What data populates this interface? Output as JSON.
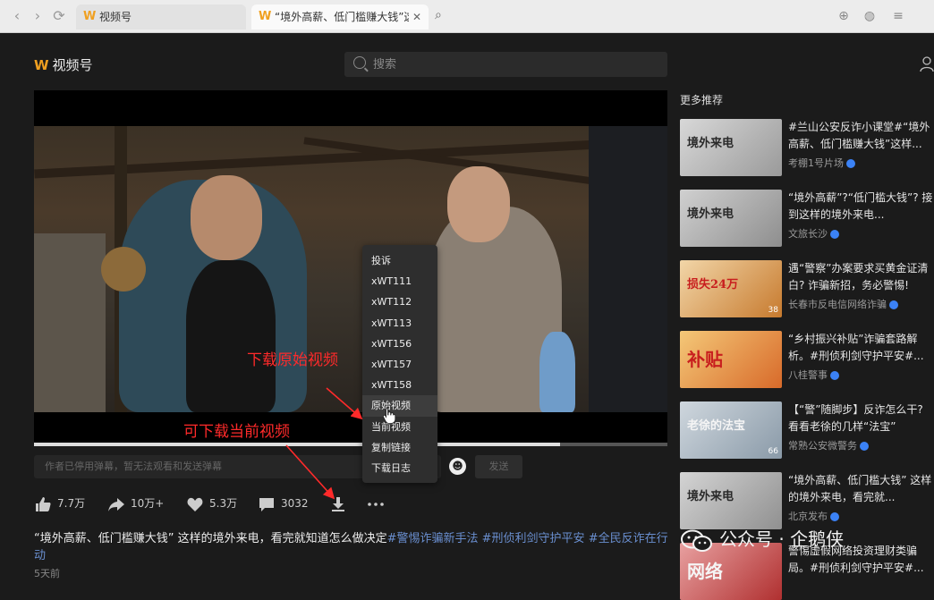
{
  "browser": {
    "tab1_title": "视频号",
    "tab2_title": "“境外高薪、低门槛赚大钱”这",
    "tab_logo": "W"
  },
  "header": {
    "logo_text": "视频号",
    "logo_mark": "W",
    "search_placeholder": "搜索"
  },
  "player": {
    "progress": 0.83,
    "danmu_placeholder": "作者已停用弹幕，暂无法观看和发送弹幕",
    "danmu_send": "发送",
    "danmu_emoji": "☻"
  },
  "actions": {
    "like_count": "7.7万",
    "share_count": "10万+",
    "heart_count": "5.3万",
    "comment_count": "3032"
  },
  "context_menu": {
    "items": [
      "投诉",
      "xWT111",
      "xWT112",
      "xWT113",
      "xWT156",
      "xWT157",
      "xWT158",
      "原始视频",
      "当前视频",
      "复制链接",
      "下载日志"
    ],
    "highlighted_index": 7
  },
  "annotations": {
    "download_original": "下载原始视频",
    "download_current": "可下载当前视频",
    "color": "#ff2a2a"
  },
  "video_info": {
    "title_main": "“境外高薪、低门槛赚大钱” 这样的境外来电，看完就知道怎么做决定",
    "tag1": "#警惕诈骗新手法",
    "tag2": "#刑侦利剑守护平安",
    "tag3": "#全民反诈在行动",
    "time": "5天前"
  },
  "recommendations": {
    "header": "更多推荐",
    "items": [
      {
        "title": "#兰山公安反诈小课堂#“境外高薪、低门槛赚大钱”这样...",
        "author": "考棚1号片场",
        "thumb_text": "境外来电"
      },
      {
        "title": "“境外高薪”?“低门槛大钱”? 接到这样的境外来电...",
        "author": "文旅长沙",
        "thumb_text": "境外来电"
      },
      {
        "title": "遇“警察”办案要求买黄金证清白? 诈骗新招，务必警惕!",
        "author": "长春市反电信网络诈骗",
        "thumb_text": "损失24万",
        "likes": "38"
      },
      {
        "title": "“乡村振兴补贴”诈骗套路解析。#刑侦利剑守护平安#...",
        "author": "八桂警事",
        "thumb_text": "补贴"
      },
      {
        "title": "【“警”随脚步】反诈怎么干? 看看老徐的几样“法宝”",
        "author": "常熟公安微警务",
        "thumb_text": "老徐的法宝",
        "likes": "66"
      },
      {
        "title": "“境外高薪、低门槛大钱” 这样的境外来电，看完就...",
        "author": "北京发布",
        "thumb_text": "境外来电"
      },
      {
        "title": "警惕虚假网络投资理财类骗局。#刑侦利剑守护平安#...",
        "author": "",
        "thumb_text": "网络"
      }
    ]
  },
  "watermark": {
    "text": "公众号 · 企鹅侠"
  }
}
